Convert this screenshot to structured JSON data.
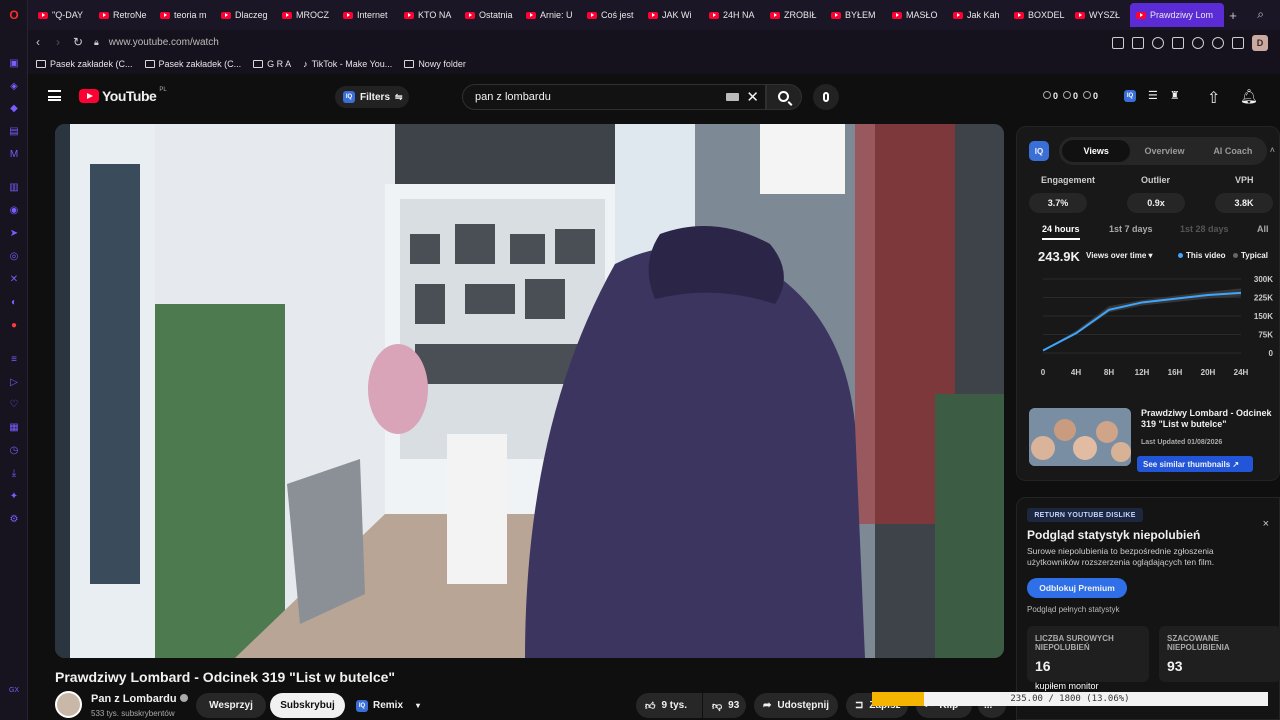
{
  "browser": {
    "tabs": [
      {
        "label": "\"Q-DAY"
      },
      {
        "label": "RetroNe"
      },
      {
        "label": "teoria m"
      },
      {
        "label": "Dlaczeg"
      },
      {
        "label": "MROCZ"
      },
      {
        "label": "Internet"
      },
      {
        "label": "KTO NA"
      },
      {
        "label": "Ostatnia"
      },
      {
        "label": "Arnie: U"
      },
      {
        "label": "Coś jest"
      },
      {
        "label": "JAK Wi"
      },
      {
        "label": "24H NA"
      },
      {
        "label": "ZROBIŁ"
      },
      {
        "label": "BYŁEM"
      },
      {
        "label": "MASŁO"
      },
      {
        "label": "Jak Kah"
      },
      {
        "label": "BOXDEL"
      },
      {
        "label": "WYSZŁ"
      },
      {
        "label": "Prawdziwy Lom",
        "active": true
      }
    ],
    "new_tab": "+",
    "url": "www.youtube.com/watch",
    "profile_initial": "D",
    "bookmarks": [
      {
        "label": "Pasek zakładek (C...",
        "icon": "folder-icon"
      },
      {
        "label": "Pasek zakładek (C...",
        "icon": "folder-icon"
      },
      {
        "label": "G R A",
        "icon": "folder-icon"
      },
      {
        "label": "TikTok - Make You...",
        "icon": "tiktok-icon"
      },
      {
        "label": "Nowy folder",
        "icon": "folder-icon"
      }
    ],
    "accent": "#5b2bd6"
  },
  "youtube": {
    "logo_text": "YouTube",
    "logo_country": "PL",
    "filters_label": "Filters",
    "search_value": "pan z lombardu",
    "header_stats": [
      "0",
      "0",
      "0"
    ],
    "video": {
      "title": "Prawdziwy Lombard - Odcinek 319 \"List w butelce\"",
      "channel": "Pan z Lombardu",
      "subscribers": "533 tys. subskrybentów",
      "support_label": "Wesprzyj",
      "subscribe_label": "Subskrybuj",
      "remix_label": "Remix",
      "likes": "9 tys.",
      "dislikes": "93",
      "share_label": "Udostępnij",
      "save_label": "Zapisz",
      "clip_label": "Klip",
      "more_label": "..."
    }
  },
  "iq_panel": {
    "logo": "IQ",
    "tabs": [
      "Views",
      "Overview",
      "AI Coach"
    ],
    "active_tab": "Views",
    "metrics": [
      {
        "label": "Engagement",
        "value": "3.7%"
      },
      {
        "label": "Outlier",
        "value": "0.9x"
      },
      {
        "label": "VPH",
        "value": "3.8K"
      }
    ],
    "time_tabs": [
      "24 hours",
      "1st 7 days",
      "1st 28 days",
      "All"
    ],
    "total_views": "243.9K",
    "views_dropdown": "Views over time",
    "legend": [
      {
        "name": "This video",
        "color": "#3ea6ff"
      },
      {
        "name": "Typical",
        "color": "#666666"
      }
    ],
    "thumb_title": "Prawdziwy Lombard - Odcinek 319 \"List w butelce\"",
    "thumb_updated": "Last Updated 01/08/2026",
    "similar_button": "See similar thumbnails ↗"
  },
  "chart_data": {
    "type": "line",
    "x": [
      "0",
      "4H",
      "8H",
      "12H",
      "16H",
      "20H",
      "24H"
    ],
    "ylim": [
      0,
      300000
    ],
    "yticks": [
      "300K",
      "225K",
      "150K",
      "75K",
      "0"
    ],
    "series": [
      {
        "name": "This video",
        "values": [
          10000,
          80000,
          175000,
          205000,
          220000,
          235000,
          243900
        ]
      },
      {
        "name": "Typical",
        "values": [
          12000,
          90000,
          190000,
          215000,
          232000,
          248000,
          262000
        ]
      }
    ]
  },
  "ryd_panel": {
    "badge": "RETURN YOUTUBE DISLIKE",
    "close": "×",
    "heading": "Podgląd statystyk niepolubień",
    "description": "Surowe niepolubienia to bezpośrednie zgłoszenia użytkowników rozszerzenia oglądających ten film.",
    "premium_button": "Odblokuj Premium",
    "full_stats": "Podgląd pełnych statystyk",
    "cards": [
      {
        "label": "LICZBA SUROWYCH NIEPOLUBIEŃ",
        "value": "16"
      },
      {
        "label": "SZACOWANE NIEPOLUBIENIA",
        "value": "93"
      }
    ]
  },
  "overlay": {
    "label": "kupiłem monitor",
    "progress_text": "235.00 / 1800 (13.06%)",
    "progress": 0.1306
  }
}
